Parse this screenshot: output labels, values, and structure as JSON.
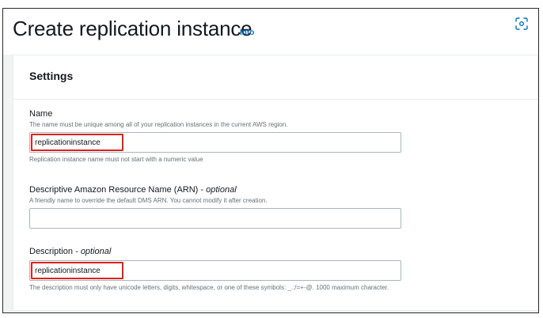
{
  "header": {
    "title": "Create replication instance",
    "info_link": "Info"
  },
  "settings": {
    "title": "Settings",
    "name": {
      "label": "Name",
      "description": "The name must be unique among all of your replication instances in the current AWS region.",
      "value": "replicationinstance",
      "constraint": "Replication instance name must not start with a numeric value"
    },
    "arn": {
      "label": "Descriptive Amazon Resource Name (ARN)",
      "optional": "optional",
      "description": "A friendly name to override the default DMS ARN. You cannot modify it after creation.",
      "value": ""
    },
    "description_field": {
      "label": "Description",
      "optional": "optional",
      "value": "replicationinstance",
      "constraint": "The description must only have unicode letters, digits, whitespace, or one of these symbols: _.:/=+-@. 1000 maximum character."
    }
  },
  "colors": {
    "highlight": "#e02020",
    "link": "#0073bb"
  }
}
